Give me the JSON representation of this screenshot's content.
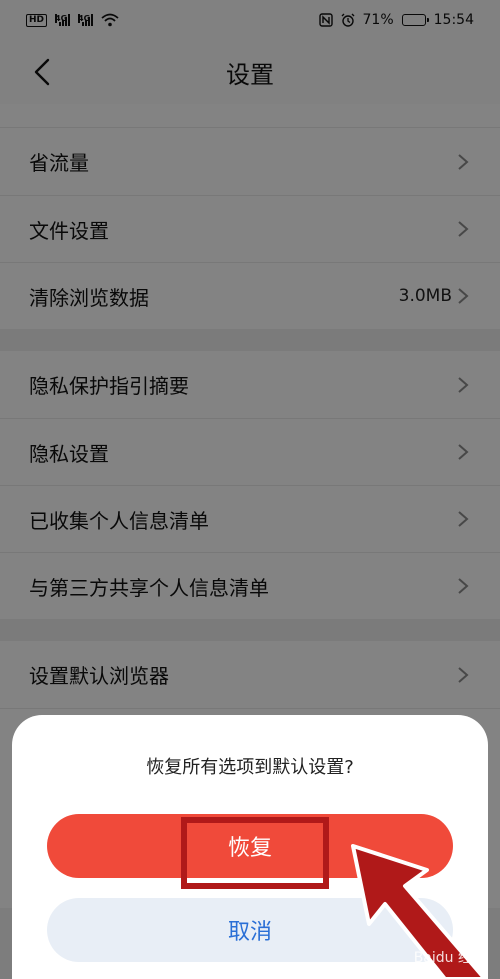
{
  "status_bar": {
    "hd_badge": "HD",
    "signal_label_1": "4G",
    "signal_label_2": "4G",
    "battery_percent": "71%",
    "battery_level": 0.71,
    "time": "15:54"
  },
  "header": {
    "title": "设置"
  },
  "settings": {
    "group1": [
      {
        "label": "省流量"
      },
      {
        "label": "文件设置"
      },
      {
        "label": "清除浏览数据",
        "value": "3.0MB"
      }
    ],
    "group2": [
      {
        "label": "隐私保护指引摘要"
      },
      {
        "label": "隐私设置"
      },
      {
        "label": "已收集个人信息清单"
      },
      {
        "label": "与第三方共享个人信息清单"
      }
    ],
    "group3": [
      {
        "label": "设置默认浏览器"
      }
    ]
  },
  "dialog": {
    "message": "恢复所有选项到默认设置?",
    "confirm_label": "恢复",
    "cancel_label": "取消"
  },
  "colors": {
    "confirm_button": "#f04a3a",
    "cancel_text": "#2a6fd6",
    "annotation": "#b01919"
  },
  "watermark": "Baidu 经验"
}
